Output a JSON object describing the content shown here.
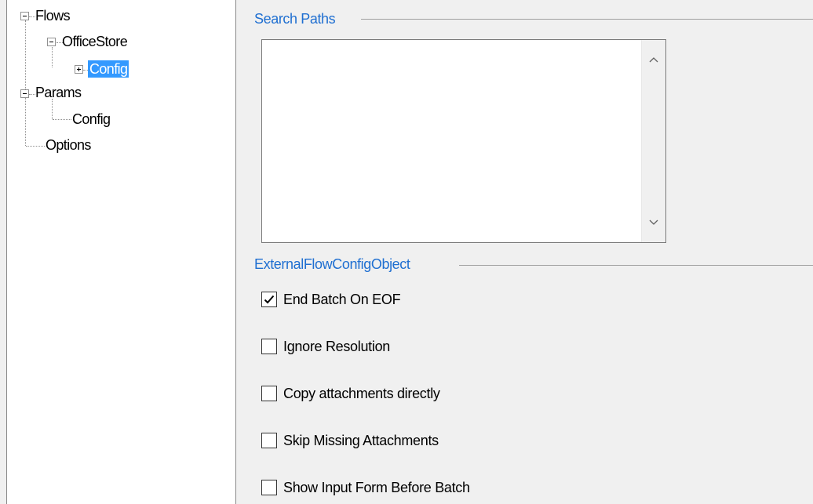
{
  "tree": {
    "nodes": [
      {
        "label": "Flows",
        "state": "expanded"
      },
      {
        "label": "OfficeStore",
        "state": "expanded"
      },
      {
        "label": "Config",
        "state": "collapsed",
        "selected": true
      },
      {
        "label": "Params",
        "state": "expanded"
      },
      {
        "label": "Config",
        "state": "leaf"
      },
      {
        "label": "Options",
        "state": "leaf"
      }
    ],
    "selection_color": "#3399ff"
  },
  "search_paths": {
    "title": "Search Paths",
    "items": []
  },
  "config_group": {
    "title": "ExternalFlowConfigObject",
    "options": [
      {
        "label": "End Batch On EOF",
        "checked": true
      },
      {
        "label": "Ignore Resolution",
        "checked": false
      },
      {
        "label": "Copy attachments directly",
        "checked": false
      },
      {
        "label": "Skip Missing Attachments",
        "checked": false
      },
      {
        "label": "Show Input Form Before Batch",
        "checked": false
      }
    ]
  },
  "colors": {
    "group_title": "#1f6fd1",
    "panel_bg": "#f0f0f0",
    "tree_bg": "#ffffff"
  }
}
